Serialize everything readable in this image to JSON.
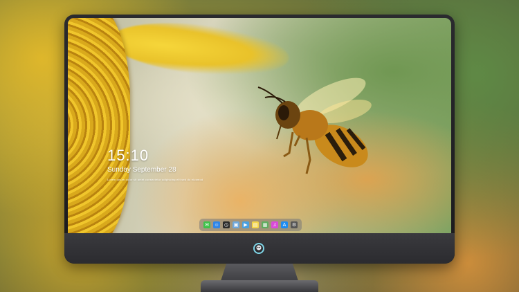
{
  "lock_screen": {
    "time": "15:10",
    "date": "Sunday September 28",
    "fine_print": "Lorem ipsum dolor sit amet consectetur adipiscing elit sed do eiusmod"
  },
  "dock": {
    "items": [
      {
        "name": "messages",
        "icon": "messages-icon",
        "color": "#3ec24a",
        "glyph": "✉"
      },
      {
        "name": "finder",
        "icon": "finder-icon",
        "color": "#2f86e8",
        "glyph": "☺"
      },
      {
        "name": "clock",
        "icon": "clock-icon",
        "color": "#2a2a2a",
        "glyph": "◷"
      },
      {
        "name": "photos",
        "icon": "photos-icon",
        "color": "#6fa8dc",
        "glyph": "▣"
      },
      {
        "name": "claquette",
        "icon": "video-editor-icon",
        "color": "#4aa0e0",
        "glyph": "▶"
      },
      {
        "name": "notes",
        "icon": "notes-icon",
        "color": "#f5d64a",
        "glyph": "▤"
      },
      {
        "name": "preview",
        "icon": "preview-icon",
        "color": "#5fae5f",
        "glyph": "▦"
      },
      {
        "name": "music",
        "icon": "music-icon",
        "color": "#d94bd9",
        "glyph": "♫"
      },
      {
        "name": "app-store",
        "icon": "app-store-icon",
        "color": "#1e8cf0",
        "glyph": "A"
      },
      {
        "name": "system",
        "icon": "system-settings-icon",
        "color": "#555555",
        "glyph": "⚙"
      }
    ]
  },
  "colors": {
    "bezel": "#1f1f22",
    "screen_clock": "#ffffff",
    "dock_bg": "#787878"
  }
}
